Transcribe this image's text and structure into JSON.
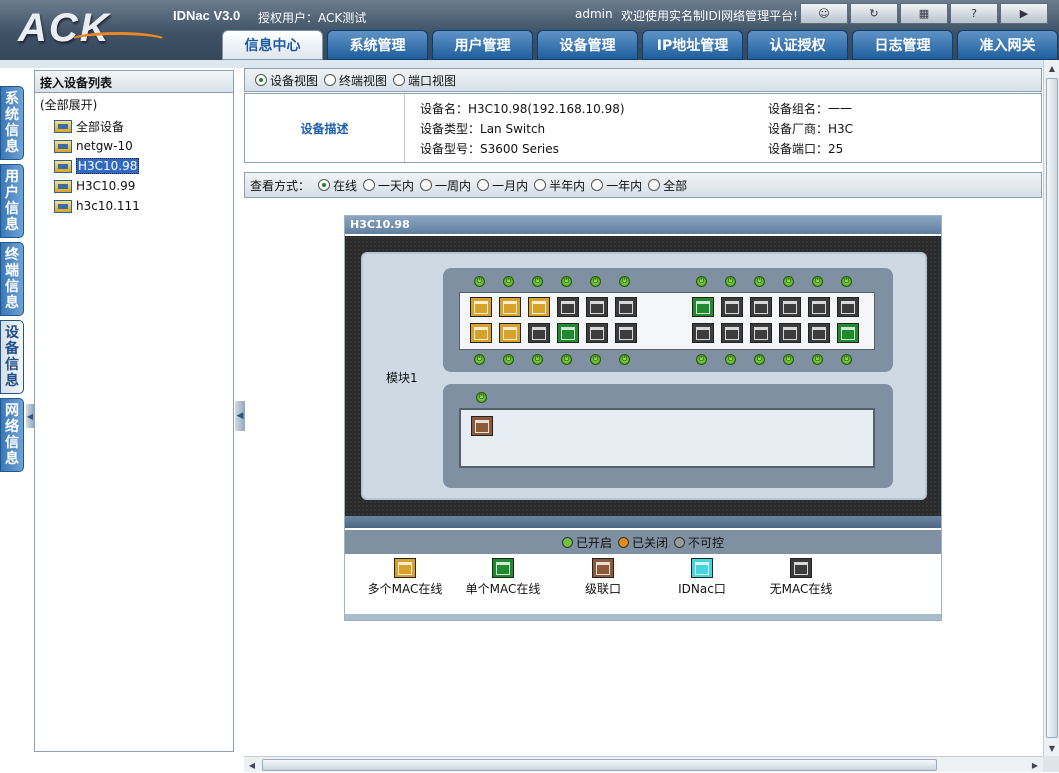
{
  "header": {
    "logo": "ACK",
    "version": "IDNac V3.0",
    "auth_user": "授权用户：ACK测试",
    "admin": "admin",
    "welcome": "欢迎使用实名制IDl网络管理平台!",
    "tool_icons": [
      "user-icon",
      "refresh-icon",
      "calculator-icon",
      "help-icon",
      "exit-icon"
    ]
  },
  "tabs": [
    {
      "label": "信息中心",
      "active": true
    },
    {
      "label": "系统管理"
    },
    {
      "label": "用户管理"
    },
    {
      "label": "设备管理"
    },
    {
      "label": "IP地址管理"
    },
    {
      "label": "认证授权"
    },
    {
      "label": "日志管理"
    },
    {
      "label": "准入网关"
    }
  ],
  "vtabs": [
    {
      "label": "系统信息"
    },
    {
      "label": "用户信息"
    },
    {
      "label": "终端信息"
    },
    {
      "label": "设备信息",
      "active": true
    },
    {
      "label": "网络信息"
    }
  ],
  "left": {
    "title": "接入设备列表",
    "expand": "(全部展开)",
    "items": [
      {
        "label": "全部设备"
      },
      {
        "label": "netgw-10"
      },
      {
        "label": "H3C10.98",
        "selected": true
      },
      {
        "label": "H3C10.99"
      },
      {
        "label": "h3c10.111"
      }
    ]
  },
  "views": [
    "设备视图",
    "终端视图",
    "端口视图"
  ],
  "device": {
    "section": "设备描述",
    "name_k": "设备名：",
    "name_v": "H3C10.98(192.168.10.98)",
    "type_k": "设备类型：",
    "type_v": "Lan Switch",
    "model_k": "设备型号：",
    "model_v": "S3600 Series",
    "group_k": "设备组名：",
    "group_v": "一一",
    "vendor_k": "设备厂商：",
    "vendor_v": "H3C",
    "port_k": "设备端口：",
    "port_v": "25"
  },
  "query": {
    "label": "查看方式：",
    "options": [
      "在线",
      "一天内",
      "一周内",
      "一月内",
      "半年内",
      "一年内",
      "全部"
    ],
    "selected": 0
  },
  "panel": {
    "title": "H3C10.98",
    "module": "模块1",
    "top_row": [
      "multi",
      "multi",
      "multi",
      "none",
      "none",
      "none",
      "single",
      "none",
      "none",
      "none",
      "none",
      "none"
    ],
    "bottom_row": [
      "multi",
      "multi",
      "none",
      "single",
      "none",
      "none",
      "none",
      "none",
      "none",
      "none",
      "none",
      "single"
    ],
    "sub_ports": [
      "casc"
    ]
  },
  "legend_status": [
    {
      "label": "已开启",
      "color": "#6fc23a"
    },
    {
      "label": "已关闭",
      "color": "#e38a1c"
    },
    {
      "label": "不可控",
      "color": "#9a9a9a"
    }
  ],
  "legend_ports": [
    {
      "label": "多个MAC在线",
      "type": "multi"
    },
    {
      "label": "单个MAC在线",
      "type": "single"
    },
    {
      "label": "级联口",
      "type": "casc"
    },
    {
      "label": "IDNac口",
      "type": "idnac"
    },
    {
      "label": "无MAC在线",
      "type": "none"
    }
  ]
}
